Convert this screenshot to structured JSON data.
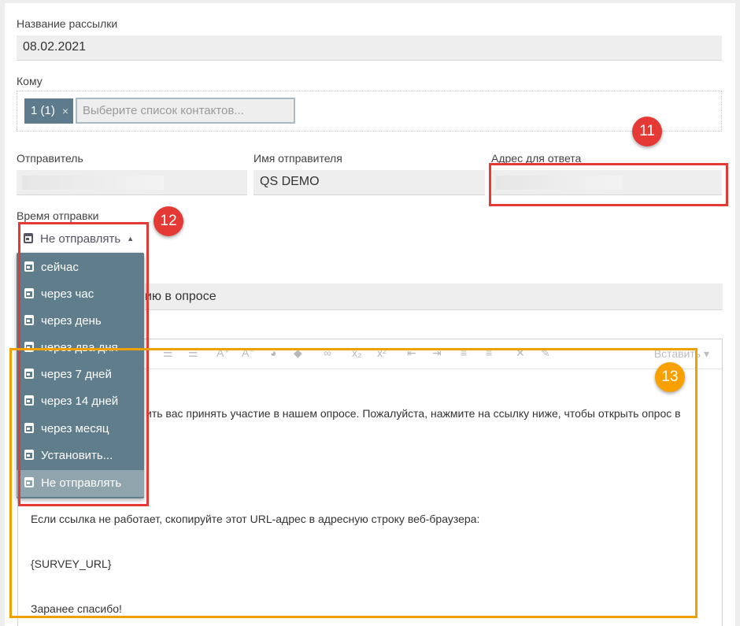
{
  "campaign_name": {
    "label": "Название рассылки",
    "value": "08.02.2021"
  },
  "recipients": {
    "label": "Кому",
    "chip": "1 (1)",
    "chip_remove": "×",
    "placeholder": "Выберите список контактов..."
  },
  "sender": {
    "label": "Отправитель"
  },
  "sender_name": {
    "label": "Имя отправителя",
    "value": "QS DEMO"
  },
  "reply_to": {
    "label": "Адрес для ответа"
  },
  "send_time": {
    "label": "Время отправки",
    "selected": "Не отправлять",
    "options": [
      "сейчас",
      "через час",
      "через день",
      "через два дня",
      "через 7 дней",
      "через 14 дней",
      "через месяц",
      "Установить...",
      "Не отправлять"
    ]
  },
  "subject_partial": "ию в опросе",
  "editor": {
    "insert_label": "Вставить",
    "body_line1": "ить вас принять участие в нашем опросе. Пожалуйста, нажмите на ссылку ниже, чтобы открыть опрос в",
    "body_line2": "Если ссылка не работает, скопируйте этот URL-адрес в адресную строку веб-браузера:",
    "body_line3": "{SURVEY_URL}",
    "body_line4": "Заранее спасибо!"
  },
  "callouts": {
    "c11": "11",
    "c12": "12",
    "c13": "13"
  },
  "colors": {
    "menu_bg": "#607d8b",
    "menu_selected": "#90a4ae",
    "callout_red": "#e53935",
    "callout_orange": "#f7a000"
  }
}
